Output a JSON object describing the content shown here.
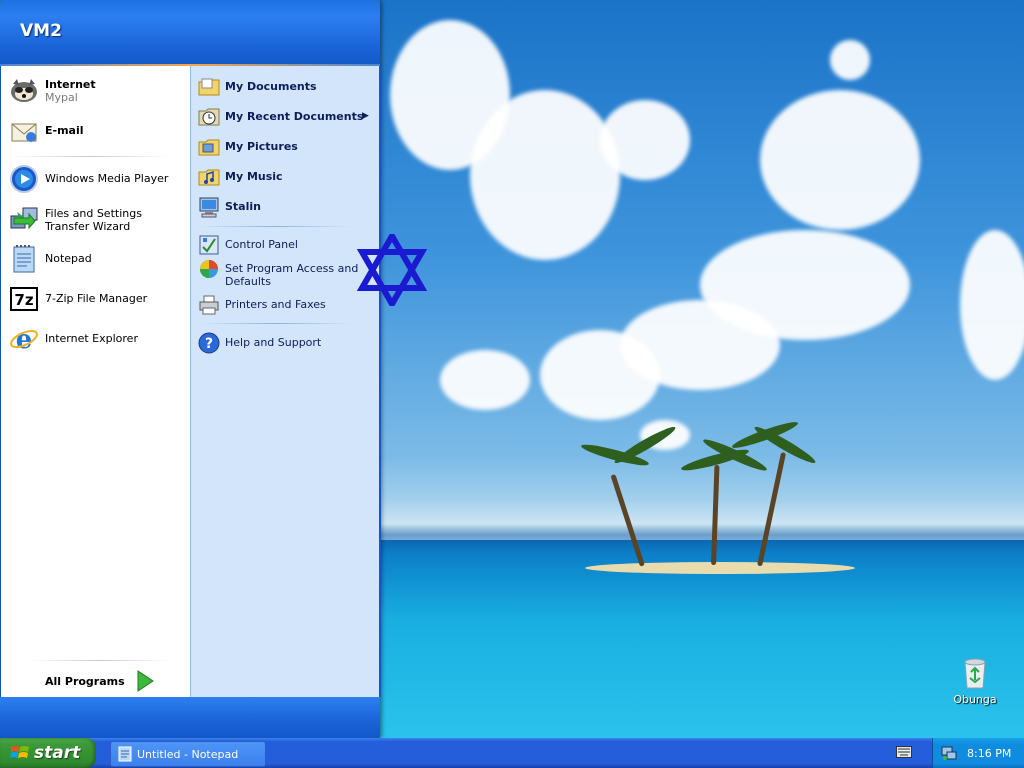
{
  "start_menu": {
    "user_name": "VM2",
    "pinned": [
      {
        "title": "Internet",
        "subtitle": "Mypal",
        "icon": "raccoon-browser-icon"
      },
      {
        "title": "E-mail",
        "icon": "mail-icon"
      }
    ],
    "recent": [
      {
        "title": "Windows Media Player",
        "icon": "media-player-icon"
      },
      {
        "title": "Files and Settings Transfer Wizard",
        "icon": "transfer-wizard-icon"
      },
      {
        "title": "Notepad",
        "icon": "notepad-icon"
      },
      {
        "title": "7-Zip File Manager",
        "icon": "7zip-icon"
      },
      {
        "title": "Internet Explorer",
        "icon": "ie-icon"
      }
    ],
    "all_programs_label": "All Programs",
    "places": [
      {
        "title": "My Documents",
        "icon": "folder-documents-icon"
      },
      {
        "title": "My Recent Documents",
        "icon": "recent-docs-icon",
        "has_submenu": true
      },
      {
        "title": "My Pictures",
        "icon": "folder-pictures-icon"
      },
      {
        "title": "My Music",
        "icon": "folder-music-icon"
      },
      {
        "title": "Stalin",
        "icon": "computer-icon"
      }
    ],
    "system": [
      {
        "title": "Control Panel",
        "icon": "control-panel-icon"
      },
      {
        "title": "Set Program Access and Defaults",
        "icon": "program-defaults-icon"
      },
      {
        "title": "Printers and Faxes",
        "icon": "printer-icon"
      }
    ],
    "help": {
      "title": "Help and Support",
      "icon": "help-icon"
    }
  },
  "desktop": {
    "recycle_bin_label": "Obunga"
  },
  "taskbar": {
    "start_label": "start",
    "tasks": [
      {
        "title": "Untitled - Notepad",
        "icon": "notepad-icon"
      }
    ],
    "clock": "8:16 PM"
  },
  "colors": {
    "taskbar_blue": "#245edb",
    "start_green": "#3c9a3a",
    "menu_right_panel": "#d3e5fa",
    "star_blue": "#1a1ad0"
  }
}
